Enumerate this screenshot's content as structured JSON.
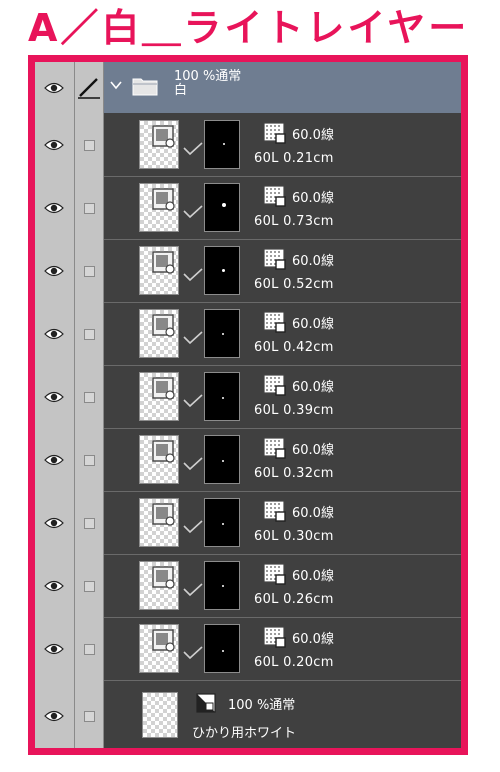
{
  "title": "A／白＿ライトレイヤー",
  "colors": {
    "accent": "#e8145a",
    "panel": "#404040",
    "folder_row": "#6f7d91",
    "gutter": "#c4c4c4"
  },
  "folder": {
    "opacity_mode": "100 %通常",
    "name": "白",
    "icon": "folder-icon"
  },
  "layers": [
    {
      "tone": "60.0線",
      "detail": "60L 0.21cm"
    },
    {
      "tone": "60.0線",
      "detail": "60L 0.73cm"
    },
    {
      "tone": "60.0線",
      "detail": "60L 0.52cm"
    },
    {
      "tone": "60.0線",
      "detail": "60L 0.42cm"
    },
    {
      "tone": "60.0線",
      "detail": "60L 0.39cm"
    },
    {
      "tone": "60.0線",
      "detail": "60L 0.32cm"
    },
    {
      "tone": "60.0線",
      "detail": "60L 0.30cm"
    },
    {
      "tone": "60.0線",
      "detail": "60L 0.26cm"
    },
    {
      "tone": "60.0線",
      "detail": "60L 0.20cm"
    }
  ],
  "last_layer": {
    "opacity_mode": "100 %通常",
    "name": "ひかり用ホワイト"
  }
}
